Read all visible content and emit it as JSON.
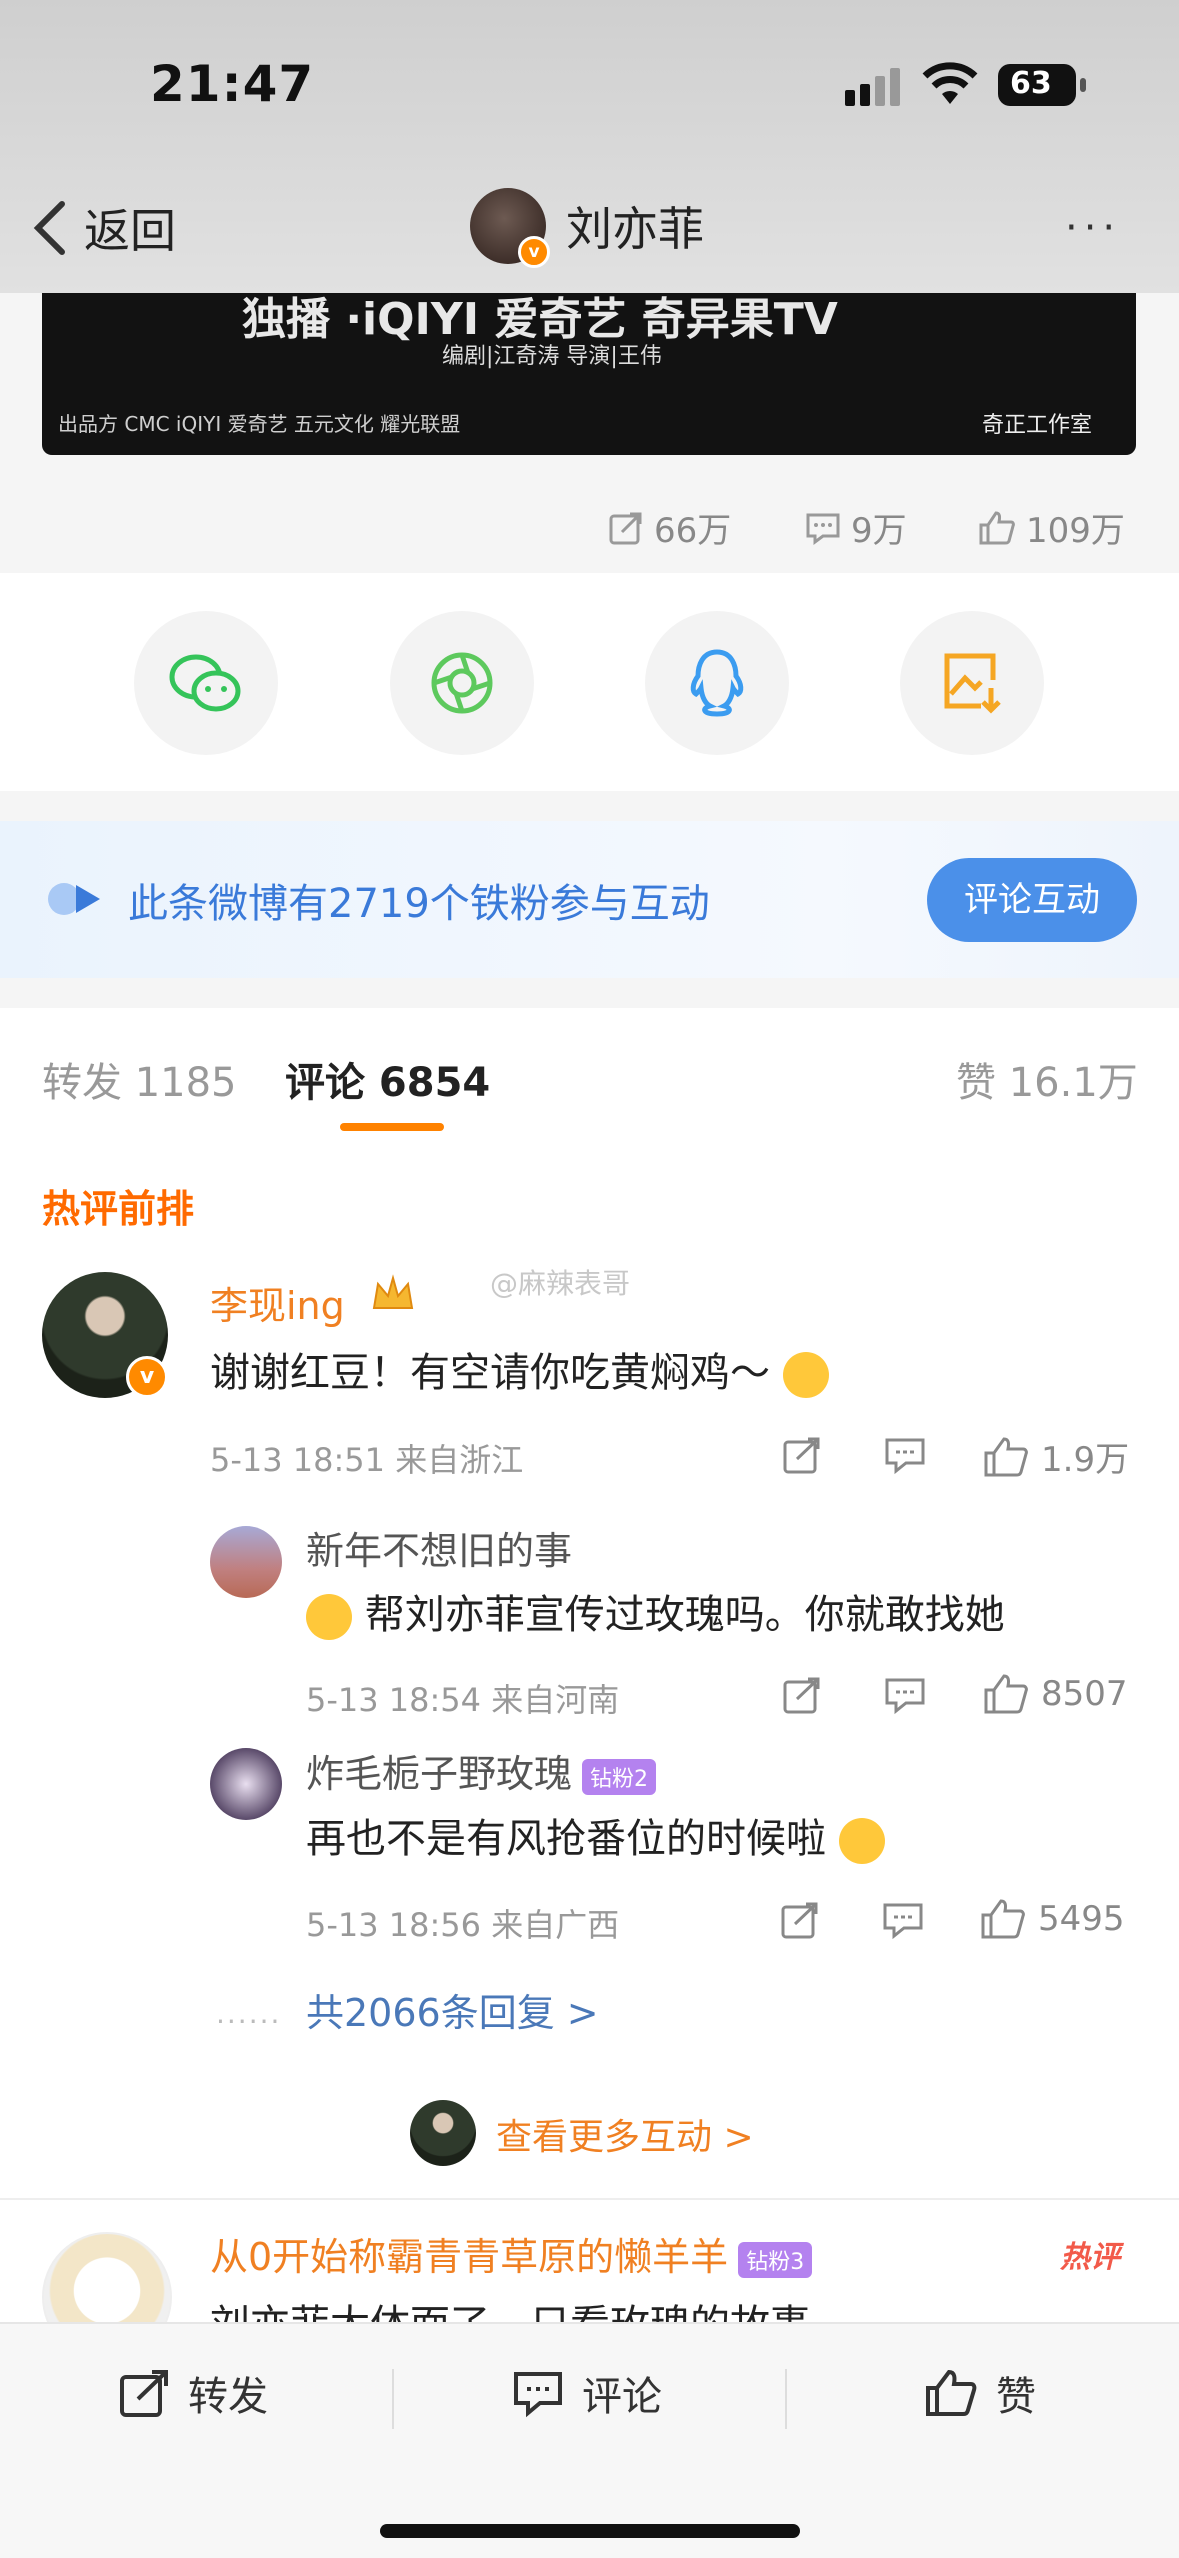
{
  "status_bar": {
    "time": "21:47",
    "battery": "63"
  },
  "nav": {
    "back_label": "返回",
    "title": "刘亦菲",
    "more": "···"
  },
  "banner": {
    "top_text": "独播 ·iQIYI 爱奇艺  奇异果TV",
    "credits": "编剧|江奇涛    导演|王伟",
    "bottom_text": "出品方   CMC   iQIYI 爱奇艺   五元文化   耀光联盟",
    "studio": "奇正工作室"
  },
  "stats": {
    "reposts": "66万",
    "comments": "9万",
    "likes": "109万"
  },
  "share": {
    "items": [
      "wechat",
      "moments",
      "qq",
      "save-image"
    ]
  },
  "fans_banner": {
    "text": "此条微博有2719个铁粉参与互动",
    "button": "评论互动"
  },
  "tabs": {
    "repost": "转发 1185",
    "comment": "评论 6854",
    "like": "赞 16.1万"
  },
  "hot_title": "热评前排",
  "watermark": "@麻辣表哥",
  "comments": [
    {
      "user": "李现ing",
      "text": "谢谢红豆！有空请你吃黄焖鸡～",
      "meta": "5-13 18:51 来自浙江",
      "likes": "1.9万",
      "replies": [
        {
          "user": "新年不想旧的事",
          "text": "帮刘亦菲宣传过玫瑰吗。你就敢找她",
          "meta": "5-13 18:54 来自河南",
          "likes": "8507"
        },
        {
          "user": "炸毛栀子野玫瑰",
          "badge": "钻粉2",
          "text": "再也不是有风抢番位的时候啦",
          "meta": "5-13 18:56 来自广西",
          "likes": "5495"
        }
      ],
      "more_replies": "共2066条回复 >",
      "view_more": "查看更多互动 >"
    },
    {
      "user": "从0开始称霸青青草原的懒羊羊",
      "badge": "钻粉3",
      "hot_tag": "热评",
      "text": "刘亦菲太体面了，只看玫瑰的故事"
    }
  ],
  "bottom_bar": {
    "repost": "转发",
    "comment": "评论",
    "like": "赞"
  }
}
